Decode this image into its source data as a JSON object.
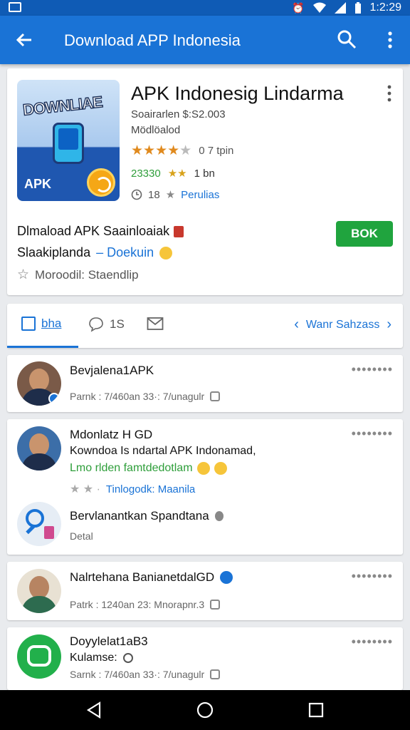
{
  "status_bar": {
    "time": "1:2:29",
    "icons": [
      "notification-icon",
      "alarm-icon",
      "wifi-icon",
      "signal-icon",
      "battery-icon"
    ]
  },
  "app_bar": {
    "title": "Download APP Indonesia",
    "icons": [
      "back-arrow-icon",
      "search-icon",
      "more-vert-icon"
    ]
  },
  "app_card": {
    "icon_text": "DOWNLIAE",
    "icon_apk": "APK",
    "title": "APK Indonesig Lindarma",
    "line1": "Soairarlen $:S2.003",
    "line2": "Mödlöalod",
    "rating": {
      "stars": 4,
      "max": 5,
      "label": "0 7 tpin"
    },
    "downloads": {
      "count": "23330",
      "stars": "★★",
      "size": "1 bn"
    },
    "meta": {
      "count": "18",
      "link": "Perulias"
    },
    "desc_line1": "Dlmaload APK Saainloaiak",
    "desc_line2": "Slaakiplanda",
    "desc_link": "Doekuin",
    "desc_line3": "Moroodil: Staendlip",
    "install_label": "BOK",
    "colors": {
      "primary": "#1a73d6",
      "install": "#20a43e",
      "star": "#e08a1e"
    }
  },
  "tabs": {
    "items": [
      {
        "label": "bha",
        "active": true
      },
      {
        "label": "1S",
        "active": false
      },
      {
        "label": "",
        "active": false
      }
    ],
    "right_label": "Wanr Sahzass"
  },
  "feed": [
    {
      "name": "Bevjalena1APK",
      "meta": "Parnk : 7/460an 33·: 7/unagulr"
    },
    {
      "name": "Mdonlatz H GD",
      "body": "Kowndoa Is ndartal APK Indonamad,",
      "green": "Lmo rlden famtdedotlam",
      "tags": "Tinlogodk: Maanila",
      "sub_name": "Bervlanantkan Spandtana",
      "sub_meta": "Detal"
    },
    {
      "name": "Nalrtehana BanianetdalGD",
      "meta": "Patrk : 1240an 23: Mnorapnr.3"
    },
    {
      "name": "Doyylelat1aB3",
      "line2": "Kulamse:",
      "meta": "Sarnk : 7/460an 33·: 7/unagulr"
    }
  ]
}
